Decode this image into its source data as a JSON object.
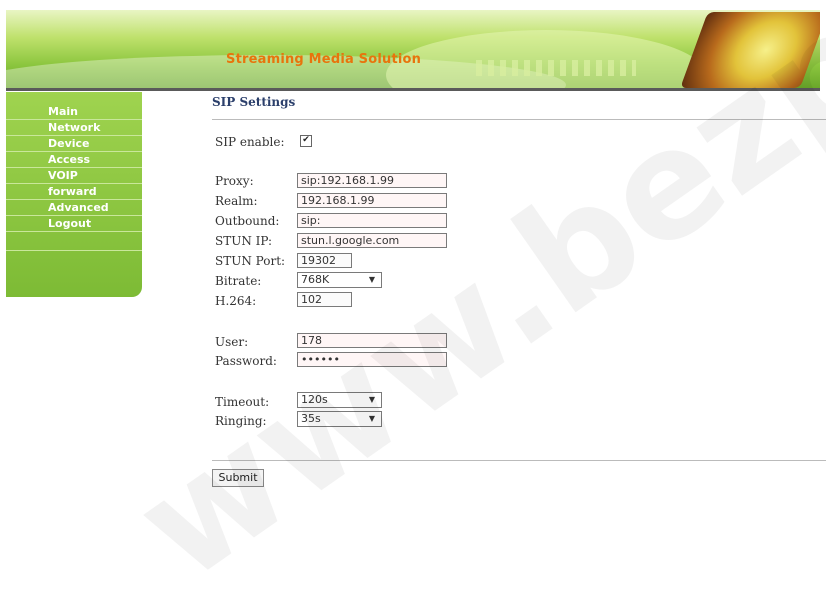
{
  "header": {
    "title": "Streaming Media Solution"
  },
  "sidebar": {
    "items": [
      {
        "label": "Main"
      },
      {
        "label": "Network"
      },
      {
        "label": "Device"
      },
      {
        "label": "Access"
      },
      {
        "label": "VOIP"
      },
      {
        "label": "forward"
      },
      {
        "label": "Advanced"
      },
      {
        "label": "Logout"
      }
    ]
  },
  "main": {
    "section_title": "SIP Settings",
    "sip_enable": {
      "label": "SIP enable:",
      "checked": true
    },
    "fields": {
      "proxy": {
        "label": "Proxy:",
        "value": "sip:192.168.1.99"
      },
      "realm": {
        "label": "Realm:",
        "value": "192.168.1.99"
      },
      "outbound": {
        "label": "Outbound:",
        "value": "sip:"
      },
      "stun_ip": {
        "label": "STUN IP:",
        "value": "stun.l.google.com"
      },
      "stun_port": {
        "label": "STUN Port:",
        "value": "19302"
      },
      "bitrate": {
        "label": "Bitrate:",
        "value": "768K"
      },
      "h264": {
        "label": "H.264:",
        "value": "102"
      },
      "user": {
        "label": "User:",
        "value": "178"
      },
      "password": {
        "label": "Password:",
        "value": "••••••"
      },
      "timeout": {
        "label": "Timeout:",
        "value": "120s"
      },
      "ringing": {
        "label": "Ringing:",
        "value": "35s"
      }
    },
    "submit_label": "Submit"
  },
  "watermark": "www.bezpek",
  "colors": {
    "accent_green": "#8cc63f",
    "title_orange": "#e8740c",
    "heading_blue": "#2b3f6b"
  }
}
